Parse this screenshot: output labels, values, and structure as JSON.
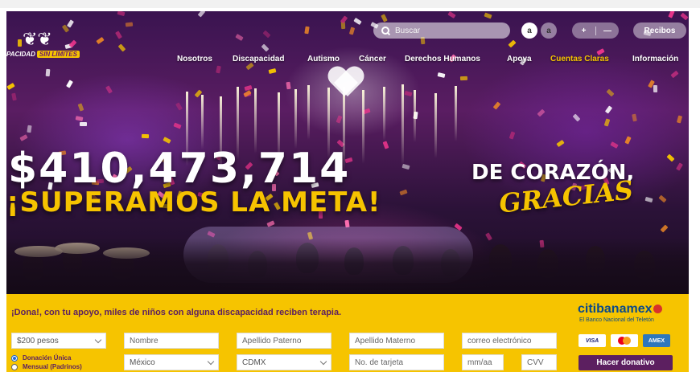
{
  "header": {
    "logo_text": "PACIDAD",
    "logo_badge": "SIN LÍMITES",
    "search_placeholder": "Buscar",
    "font_small_label": "a",
    "font_large_label": "a",
    "zoom_in_label": "+",
    "zoom_out_label": "—",
    "receipts_label": "Recibos"
  },
  "nav": {
    "items": [
      "Nosotros",
      "Discapacidad",
      "Autismo",
      "Cáncer",
      "Derechos Humanos",
      "Apoya",
      "Cuentas Claras",
      "Información"
    ],
    "active_index": 6
  },
  "hero": {
    "amount": "$410,473,714",
    "headline": "¡SUPERAMOS LA META!",
    "subheading": "DE CORAZÓN,",
    "script_text": "GRACIAS"
  },
  "donation": {
    "title": "¡Dona!, con tu apoyo, miles de niños con alguna discapacidad reciben terapia.",
    "bank_name": "citibanamex",
    "bank_subtitle": "El Banco Nacional del Teletón",
    "amount_select": "$200 pesos",
    "name_placeholder": "Nombre",
    "last_name_p_placeholder": "Apellido Paterno",
    "last_name_m_placeholder": "Apellido Materno",
    "email_placeholder": "correo electrónico",
    "country_select": "México",
    "state_select": "CDMX",
    "card_placeholder": "No. de tarjeta",
    "expiry_placeholder": "mm/aa",
    "cvv_placeholder": "CVV",
    "radio_once": "Donación Única",
    "radio_monthly": "Mensual (Padrinos)",
    "cards": [
      "VISA",
      "mastercard",
      "AMEX"
    ],
    "submit_label": "Hacer donativo"
  },
  "colors": {
    "brand_purple": "#5c1f60",
    "brand_yellow": "#f6c400",
    "citi_blue": "#0a4a8a"
  }
}
